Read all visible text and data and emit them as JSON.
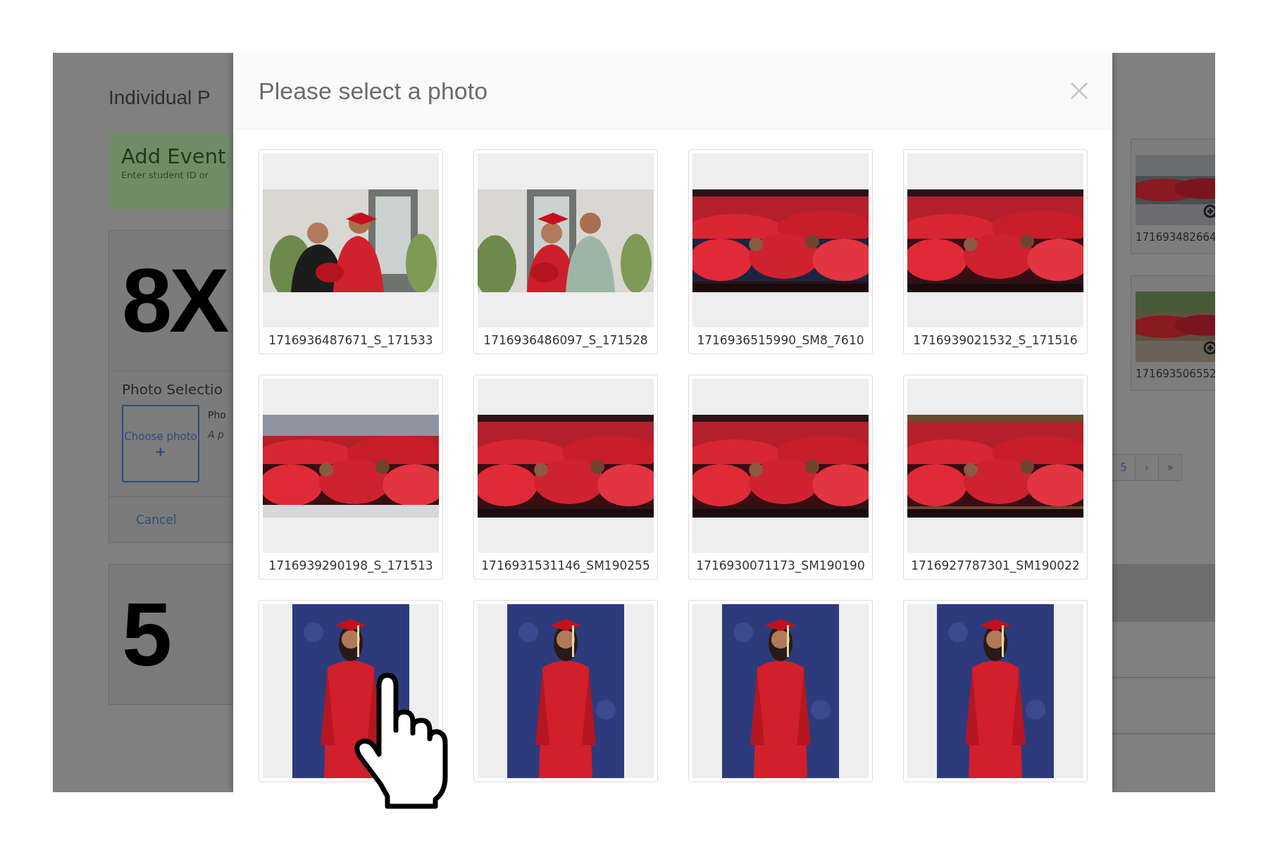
{
  "background_page": {
    "title": "Individual P",
    "event_banner": {
      "title": "Add Event",
      "subtitle": "Enter student ID or"
    },
    "products": [
      {
        "label": "8X",
        "photo_selection": {
          "heading": "Photo Selectio",
          "choose_button": {
            "label": "Choose photo",
            "plus": "+"
          },
          "field_label": "Pho",
          "field_hint": "A p",
          "cancel": "Cancel"
        }
      },
      {
        "label": "5"
      }
    ],
    "gallery": [
      {
        "kind": "picture",
        "caption": "171693482664"
      },
      {
        "kind": "picture",
        "caption": "171693506552"
      }
    ],
    "pagination": [
      "5",
      "›",
      "»"
    ]
  },
  "modal": {
    "title": "Please select a photo",
    "photos": [
      {
        "kind": "picture",
        "caption": "1716936487671_S_171533"
      },
      {
        "kind": "picture",
        "caption": "1716936486097_S_171528"
      },
      {
        "kind": "picture",
        "caption": "1716936515990_SM8_7610"
      },
      {
        "kind": "picture",
        "caption": "1716939021532_S_171516"
      },
      {
        "kind": "picture",
        "caption": "1716939290198_S_171513"
      },
      {
        "kind": "picture",
        "caption": "1716931531146_SM190255"
      },
      {
        "kind": "picture",
        "caption": "1716930071173_SM190190"
      },
      {
        "kind": "picture",
        "caption": "1716927787301_SM190022"
      },
      {
        "kind": "picture"
      },
      {
        "kind": "picture"
      },
      {
        "kind": "picture"
      },
      {
        "kind": "picture"
      }
    ]
  }
}
